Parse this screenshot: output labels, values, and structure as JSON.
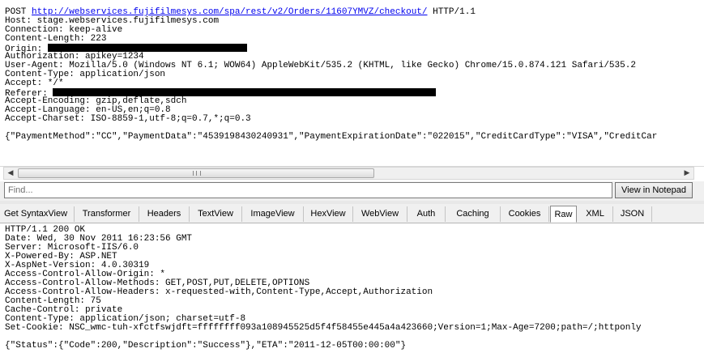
{
  "request": {
    "method": "POST",
    "url": "http://webservices.fujifilmesys.com/spa/rest/v2/Orders/11607YMVZ/checkout/",
    "protocol": "HTTP/1.1",
    "host": "Host: stage.webservices.fujifilmesys.com",
    "connection": "Connection: keep-alive",
    "content_length": "Content-Length: 223",
    "origin_label": "Origin: ",
    "authorization": "Authorization: apikey=1234",
    "user_agent": "User-Agent: Mozilla/5.0 (Windows NT 6.1; WOW64) AppleWebKit/535.2 (KHTML, like Gecko) Chrome/15.0.874.121 Safari/535.2",
    "content_type": "Content-Type: application/json",
    "accept": "Accept: */*",
    "referer_label": "Referer: ",
    "accept_encoding": "Accept-Encoding: gzip,deflate,sdch",
    "accept_language": "Accept-Language: en-US,en;q=0.8",
    "accept_charset": "Accept-Charset: ISO-8859-1,utf-8;q=0.7,*;q=0.3",
    "body": "{\"PaymentMethod\":\"CC\",\"PaymentData\":\"4539198430240931\",\"PaymentExpirationDate\":\"022015\",\"CreditCardType\":\"VISA\",\"CreditCar"
  },
  "find": {
    "placeholder": "Find...",
    "button_label": "View in Notepad"
  },
  "tabs": [
    {
      "label": "Get SyntaxView"
    },
    {
      "label": "Transformer"
    },
    {
      "label": "Headers"
    },
    {
      "label": "TextView"
    },
    {
      "label": "ImageView"
    },
    {
      "label": "HexView"
    },
    {
      "label": "WebView"
    },
    {
      "label": "Auth"
    },
    {
      "label": "Caching"
    },
    {
      "label": "Cookies"
    },
    {
      "label": "Raw",
      "selected": true
    },
    {
      "label": "XML"
    },
    {
      "label": "JSON"
    }
  ],
  "response": {
    "status": "HTTP/1.1 200 OK",
    "date": "Date: Wed, 30 Nov 2011 16:23:56 GMT",
    "server": "Server: Microsoft-IIS/6.0",
    "powered_by": "X-Powered-By: ASP.NET",
    "aspnet_version": "X-AspNet-Version: 4.0.30319",
    "acao": "Access-Control-Allow-Origin: *",
    "acam": "Access-Control-Allow-Methods: GET,POST,PUT,DELETE,OPTIONS",
    "acah": "Access-Control-Allow-Headers: x-requested-with,Content-Type,Accept,Authorization",
    "content_length": "Content-Length: 75",
    "cache_control": "Cache-Control: private",
    "content_type": "Content-Type: application/json; charset=utf-8",
    "set_cookie": "Set-Cookie: NSC_wmc-tuh-xfctfswjdft=ffffffff093a108945525d5f4f58455e445a4a423660;Version=1;Max-Age=7200;path=/;httponly",
    "body": "{\"Status\":{\"Code\":200,\"Description\":\"Success\"},\"ETA\":\"2011-12-05T00:00:00\"}"
  }
}
